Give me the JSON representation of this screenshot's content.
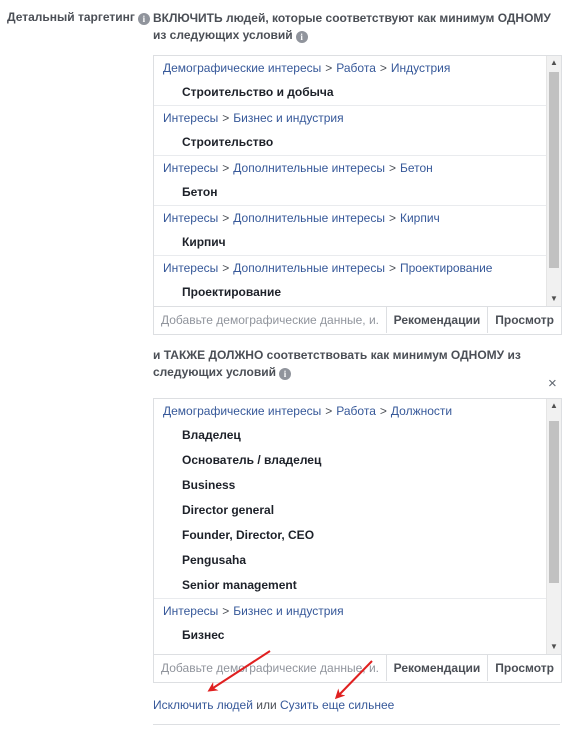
{
  "left_label": "Детальный таргетинг",
  "include": {
    "heading": "ВКЛЮЧИТЬ людей, которые соответствуют как минимум ОДНОМУ из следующих условий",
    "groups": [
      {
        "crumbs": [
          "Демографические интересы",
          "Работа",
          "Индустрия"
        ],
        "items": [
          "Строительство и добыча"
        ]
      },
      {
        "crumbs": [
          "Интересы",
          "Бизнес и индустрия"
        ],
        "items": [
          "Строительство"
        ]
      },
      {
        "crumbs": [
          "Интересы",
          "Дополнительные интересы",
          "Бетон"
        ],
        "items": [
          "Бетон"
        ]
      },
      {
        "crumbs": [
          "Интересы",
          "Дополнительные интересы",
          "Кирпич"
        ],
        "items": [
          "Кирпич"
        ]
      },
      {
        "crumbs": [
          "Интересы",
          "Дополнительные интересы",
          "Проектирование"
        ],
        "items": [
          "Проектирование"
        ]
      }
    ],
    "placeholder": "Добавьте демографические данные, и...",
    "recommendations_label": "Рекомендации",
    "browse_label": "Просмотр"
  },
  "narrow": {
    "heading": "и ТАКЖЕ ДОЛЖНО соответствовать как минимум ОДНОМУ из следующих условий",
    "close_symbol": "×",
    "groups": [
      {
        "crumbs": [
          "Демографические интересы",
          "Работа",
          "Должности"
        ],
        "items": [
          "Владелец",
          "Основатель / владелец",
          "Business",
          "Director general",
          "Founder, Director, CEO",
          "Pengusaha",
          "Senior management"
        ]
      },
      {
        "crumbs": [
          "Интересы",
          "Бизнес и индустрия"
        ],
        "items": [
          "Бизнес"
        ]
      }
    ],
    "placeholder": "Добавьте демографические данные, и...",
    "recommendations_label": "Рекомендации",
    "browse_label": "Просмотр"
  },
  "links": {
    "exclude": "Исключить людей",
    "or": " или ",
    "narrow_further": "Сузить еще сильнее"
  },
  "colors": {
    "link": "#365899",
    "annotation_arrow": "#e02020"
  }
}
